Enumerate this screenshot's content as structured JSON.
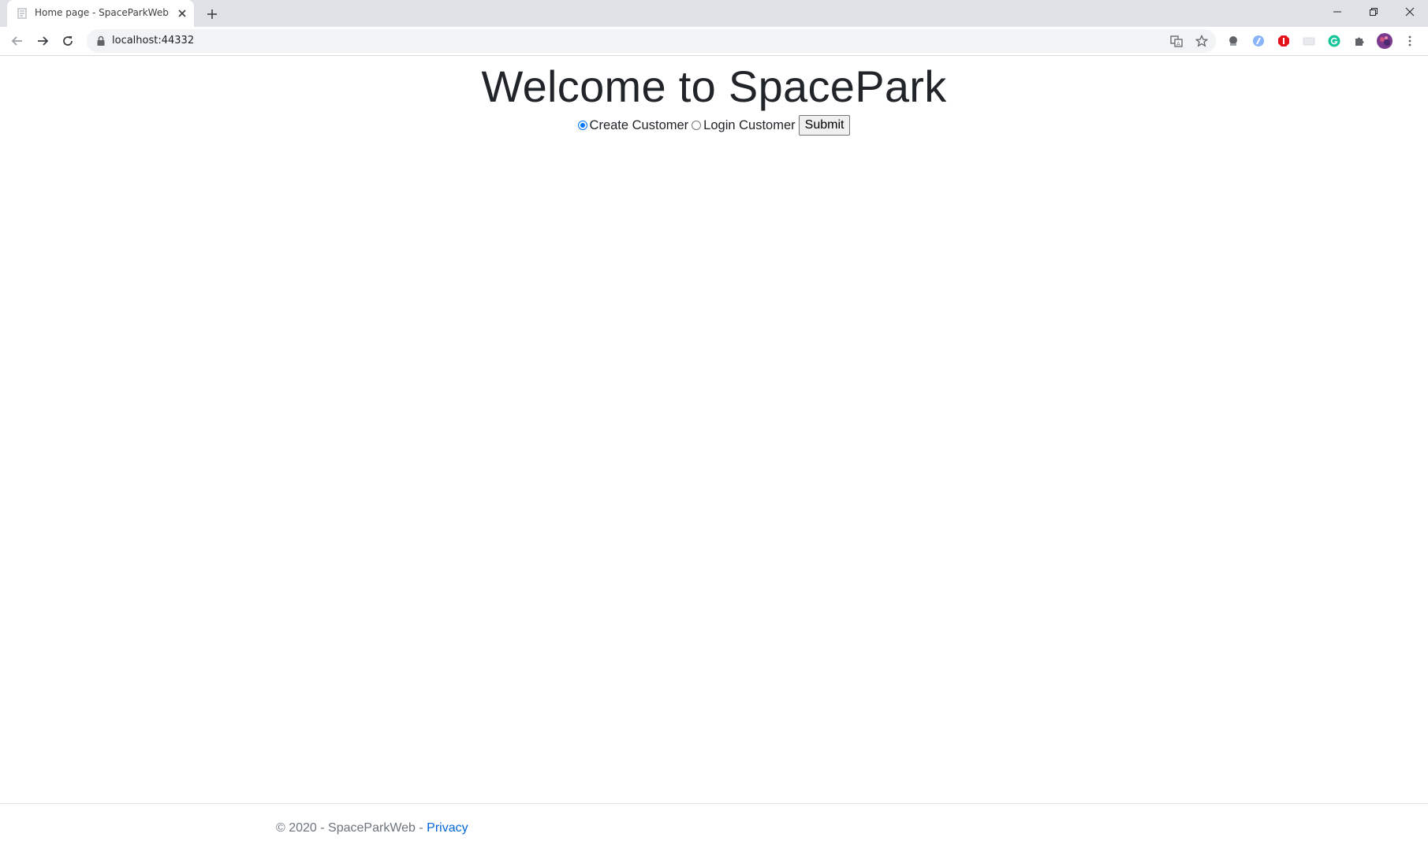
{
  "browser": {
    "tab_title": "Home page - SpaceParkWeb",
    "url": "localhost:44332",
    "icons": {
      "tab_favicon": "page-icon",
      "tab_close": "close-icon",
      "new_tab": "plus-icon",
      "back": "arrow-left-icon",
      "forward": "arrow-right-icon",
      "reload": "reload-icon",
      "lock": "lock-icon",
      "translate": "translate-icon",
      "bookmark": "star-icon",
      "extensions": [
        "extension-1-icon",
        "extension-2-icon",
        "adblock-icon",
        "extension-4-icon",
        "grammarly-icon",
        "puzzle-icon"
      ],
      "profile": "avatar-icon",
      "menu": "kebab-menu-icon",
      "window_controls": [
        "minimize-icon",
        "restore-icon",
        "close-window-icon"
      ]
    }
  },
  "page": {
    "title": "Welcome to SpacePark",
    "form": {
      "option_create": "Create Customer",
      "option_login": "Login Customer",
      "selected": "Create Customer",
      "submit_label": "Submit"
    },
    "footer": {
      "text": "© 2020 - SpaceParkWeb - ",
      "privacy_link": "Privacy"
    }
  },
  "colors": {
    "accent": "#0075ff",
    "link": "#0366d6",
    "footer_text": "#6c757d",
    "tabbar": "#dee1e6"
  }
}
